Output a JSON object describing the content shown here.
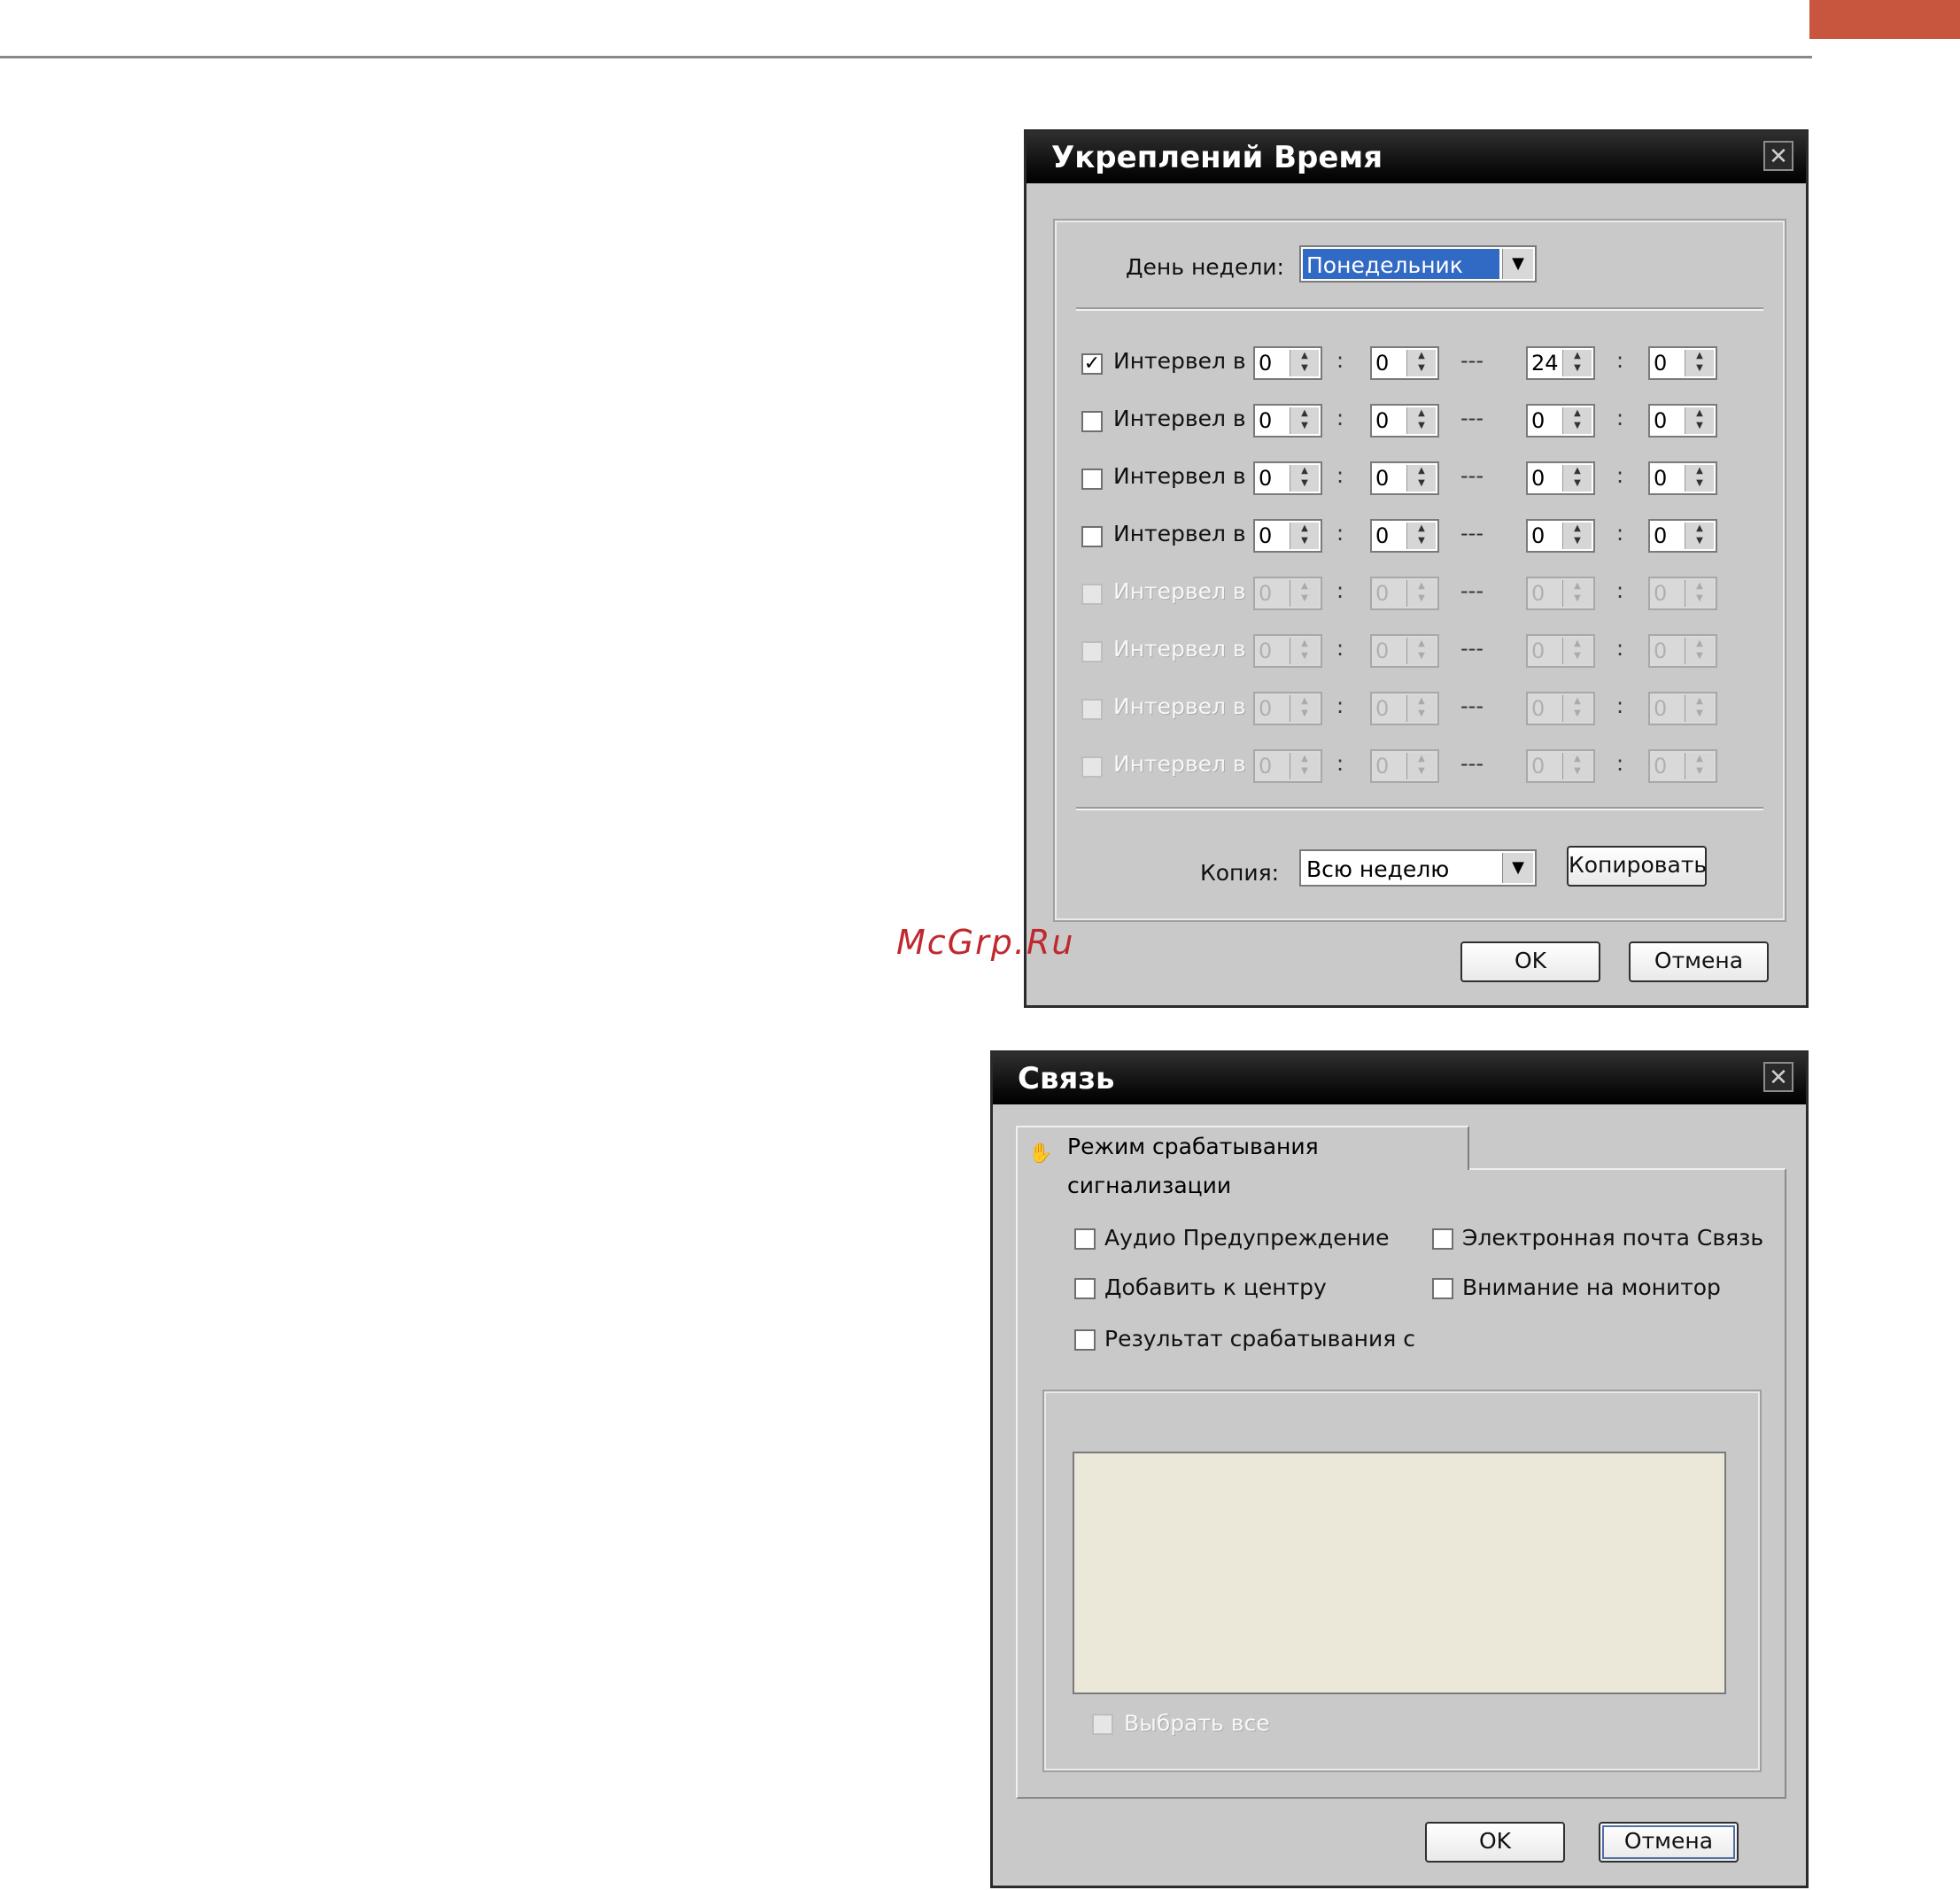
{
  "watermark": "McGrp.Ru",
  "schedule_dialog": {
    "title": "Укреплений Время",
    "weekday_label": "День недели:",
    "weekday_value": "Понедельник",
    "interval_label": "Интервел в",
    "range_sep": "---",
    "colon": ":",
    "rows": [
      {
        "checked": true,
        "enabled": true,
        "v1": "0",
        "v2": "0",
        "v3": "24",
        "v4": "0"
      },
      {
        "checked": false,
        "enabled": true,
        "v1": "0",
        "v2": "0",
        "v3": "0",
        "v4": "0"
      },
      {
        "checked": false,
        "enabled": true,
        "v1": "0",
        "v2": "0",
        "v3": "0",
        "v4": "0"
      },
      {
        "checked": false,
        "enabled": true,
        "v1": "0",
        "v2": "0",
        "v3": "0",
        "v4": "0"
      },
      {
        "checked": false,
        "enabled": false,
        "v1": "0",
        "v2": "0",
        "v3": "0",
        "v4": "0"
      },
      {
        "checked": false,
        "enabled": false,
        "v1": "0",
        "v2": "0",
        "v3": "0",
        "v4": "0"
      },
      {
        "checked": false,
        "enabled": false,
        "v1": "0",
        "v2": "0",
        "v3": "0",
        "v4": "0"
      },
      {
        "checked": false,
        "enabled": false,
        "v1": "0",
        "v2": "0",
        "v3": "0",
        "v4": "0"
      }
    ],
    "copy_label": "Копия:",
    "copy_value": "Всю неделю",
    "copy_button": "Копировать",
    "ok_button": "OK",
    "cancel_button": "Отмена"
  },
  "link_dialog": {
    "title": "Связь",
    "tab_label": "Режим срабатывания сигнализации",
    "options": {
      "audio_warning": "Аудио Предупреждение",
      "email_link": "Электронная почта Связь",
      "add_to_center": "Добавить к центру",
      "monitor_attention": "Внимание на монитор",
      "trigger_result": "Результат срабатывания с"
    },
    "select_all": "Выбрать все",
    "ok_button": "OK",
    "cancel_button": "Отмена"
  },
  "icons": {
    "close": "close-icon",
    "dropdown": "chevron-down-icon",
    "alarm": "alarm-hand-icon",
    "check": "check-icon"
  },
  "colors": {
    "accent_corner": "#c8553d",
    "titlebar": "#0c0c0c",
    "selection": "#316ac5",
    "watermark": "#c0282f"
  }
}
